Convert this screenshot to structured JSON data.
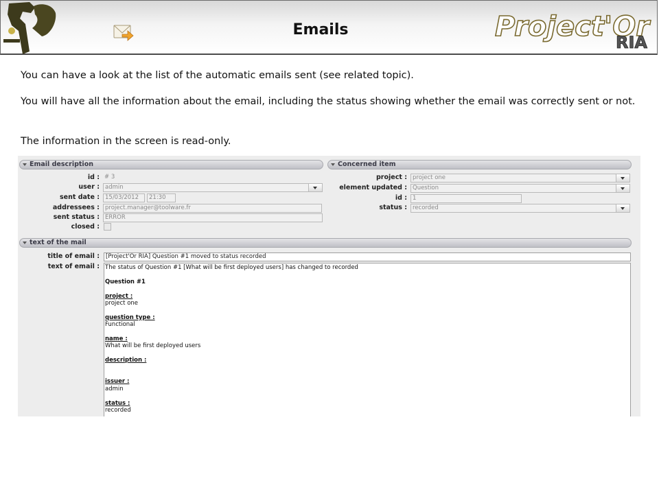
{
  "header": {
    "title": "Emails",
    "brand_text": "Project'Or",
    "brand_sub": "RIA",
    "email_icon": "envelope-arrow-icon",
    "logo_icon": "film-camera-icon"
  },
  "paragraphs": [
    "You can have a look at the list of the automatic emails sent (see related topic).",
    "You will have all the information about the email, including the status showing whether the email was correctly sent or not.",
    "The information in the screen is read-only."
  ],
  "email_description": {
    "section_title": "Email description",
    "fields": [
      {
        "label": "id :",
        "value": "# 3"
      },
      {
        "label": "user :",
        "value": "admin"
      },
      {
        "label": "sent date :",
        "value": "15/03/2012",
        "value2": "21:30"
      },
      {
        "label": "addressees :",
        "value": "project.manager@toolware.fr"
      },
      {
        "label": "sent status :",
        "value": "ERROR"
      },
      {
        "label": "closed :"
      }
    ]
  },
  "concerned_item": {
    "section_title": "Concerned item",
    "fields": [
      {
        "label": "project :",
        "value": "project one"
      },
      {
        "label": "element updated :",
        "value": "Question"
      },
      {
        "label": "id :",
        "value": "1"
      },
      {
        "label": "status :",
        "value": "recorded"
      }
    ]
  },
  "mail": {
    "section_title": "text of the mail",
    "title_label": "title of email :",
    "title_value": "[Project'Or RIA] Question #1 moved to status recorded",
    "text_label": "text of email :",
    "lines": [
      "The status of Question #1 [What will be first deployed users] has changed to recorded",
      "",
      "Question #1",
      "",
      "project :",
      "project one",
      "",
      "question type :",
      "Functional",
      "",
      "name :",
      "What will be first deployed users",
      "",
      "description :",
      "",
      "",
      "issuer :",
      "admin",
      "",
      "status :",
      "recorded"
    ],
    "line_styles": [
      "",
      "",
      "b",
      "",
      "bu",
      "",
      "",
      "bu",
      "",
      "",
      "bu",
      "",
      "",
      "bu",
      "",
      "",
      "bu",
      "",
      "",
      "bu",
      ""
    ]
  },
  "colors": {
    "section_bar_text": "#3a3a46",
    "screenshot_bg": "#ededed"
  }
}
